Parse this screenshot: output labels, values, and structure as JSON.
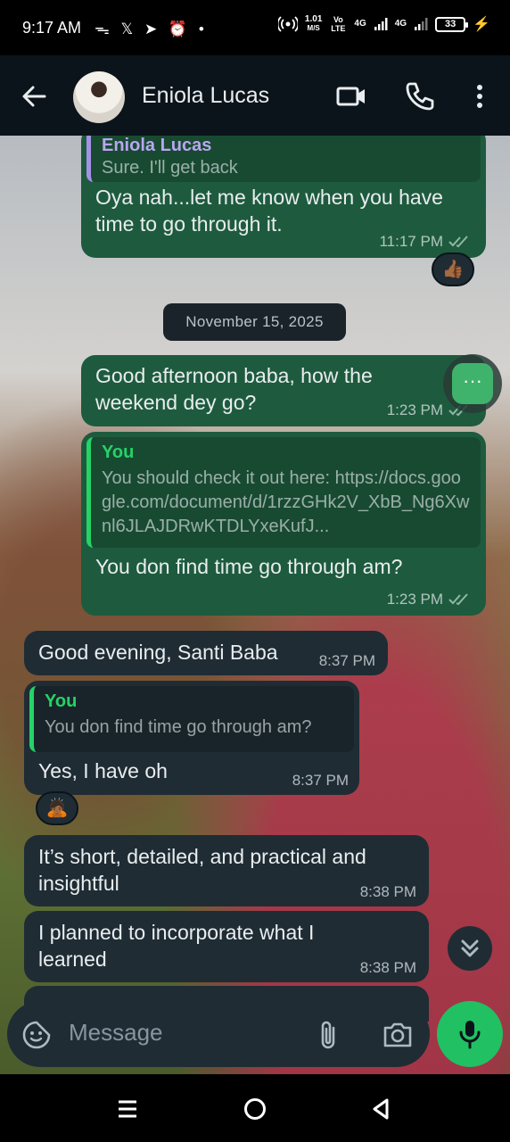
{
  "status_bar": {
    "time": "9:17 AM",
    "left_icons": [
      "threads-icon",
      "x-icon",
      "telegram-icon",
      "alarm-icon",
      "dot-icon"
    ],
    "net_speed": "1.01",
    "net_unit": "M/S",
    "volte": "Vo LTE",
    "net1": "4G",
    "net2": "4G",
    "battery": "33"
  },
  "header": {
    "contact_name": "Eniola Lucas",
    "icons": [
      "back-arrow-icon",
      "video-call-icon",
      "phone-call-icon",
      "more-options-icon"
    ]
  },
  "messages": {
    "m1": {
      "quote_name": "Eniola Lucas",
      "quote_text": "Sure. I'll get back",
      "text": "Oya nah...let me know when you have time to go through it.",
      "time": "11:17 PM",
      "reaction": "👍🏾"
    },
    "date_divider": "November 15, 2025",
    "m2": {
      "text": "Good afternoon baba, how the weekend dey go?",
      "time": "1:23 PM"
    },
    "m3": {
      "quote_name": "You",
      "quote_text": "You should check it out here: https://docs.google.com/document/d/1rzzGHk2V_XbB_Ng6Xwnl6JLAJDRwKTDLYxeKufJ...",
      "text": "You don find time go through am?",
      "time": "1:23 PM"
    },
    "m4": {
      "text": "Good evening, Santi Baba",
      "time": "8:37 PM"
    },
    "m5": {
      "quote_name": "You",
      "quote_text": "You don find time go through am?",
      "text": "Yes, I have oh",
      "time": "8:37 PM",
      "reaction": "🙇🏾"
    },
    "m6": {
      "text": "It’s short, detailed, and practical and insightful",
      "time": "8:38 PM"
    },
    "m7": {
      "text": "I planned to incorporate what I learned",
      "time": "8:38 PM"
    }
  },
  "input": {
    "placeholder": "Message"
  },
  "colors": {
    "outgoing_bubble": "#1e5b3e",
    "incoming_bubble": "#1f2c34",
    "accent_green": "#21c063",
    "quote_you": "#25d366",
    "quote_contact": "#a791e8"
  }
}
